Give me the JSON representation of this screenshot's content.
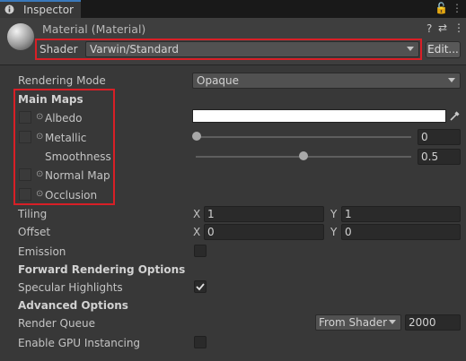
{
  "tab": {
    "title": "Inspector"
  },
  "window_icons": [
    "lock-icon",
    "menu-icon"
  ],
  "header": {
    "title": "Material (Material)",
    "icons": [
      "help-icon",
      "settings-sliders-icon",
      "more-vert-icon"
    ],
    "shader_label": "Shader",
    "shader_value": "Varwin/Standard",
    "edit_button": "Edit..."
  },
  "rendering_mode": {
    "label": "Rendering Mode",
    "value": "Opaque"
  },
  "main_maps": {
    "heading": "Main Maps",
    "albedo": {
      "label": "Albedo",
      "color": "#ffffff"
    },
    "metallic": {
      "label": "Metallic",
      "value": "0",
      "fraction": 0.0
    },
    "smoothness": {
      "label": "Smoothness",
      "value": "0.5",
      "fraction": 0.5
    },
    "normal_map": {
      "label": "Normal Map"
    },
    "occlusion": {
      "label": "Occlusion"
    }
  },
  "tiling": {
    "label": "Tiling",
    "x_label": "X",
    "x": "1",
    "y_label": "Y",
    "y": "1"
  },
  "offset": {
    "label": "Offset",
    "x_label": "X",
    "x": "0",
    "y_label": "Y",
    "y": "0"
  },
  "emission": {
    "label": "Emission",
    "checked": false
  },
  "forward_rendering": {
    "heading": "Forward Rendering Options",
    "specular_highlights": {
      "label": "Specular Highlights",
      "checked": true
    }
  },
  "advanced": {
    "heading": "Advanced Options",
    "render_queue": {
      "label": "Render Queue",
      "source": "From Shader",
      "value": "2000"
    },
    "gpu_instancing": {
      "label": "Enable GPU Instancing",
      "checked": false
    }
  },
  "colors": {
    "highlight": "#d81f26",
    "tab_accent": "#3a79bb"
  }
}
